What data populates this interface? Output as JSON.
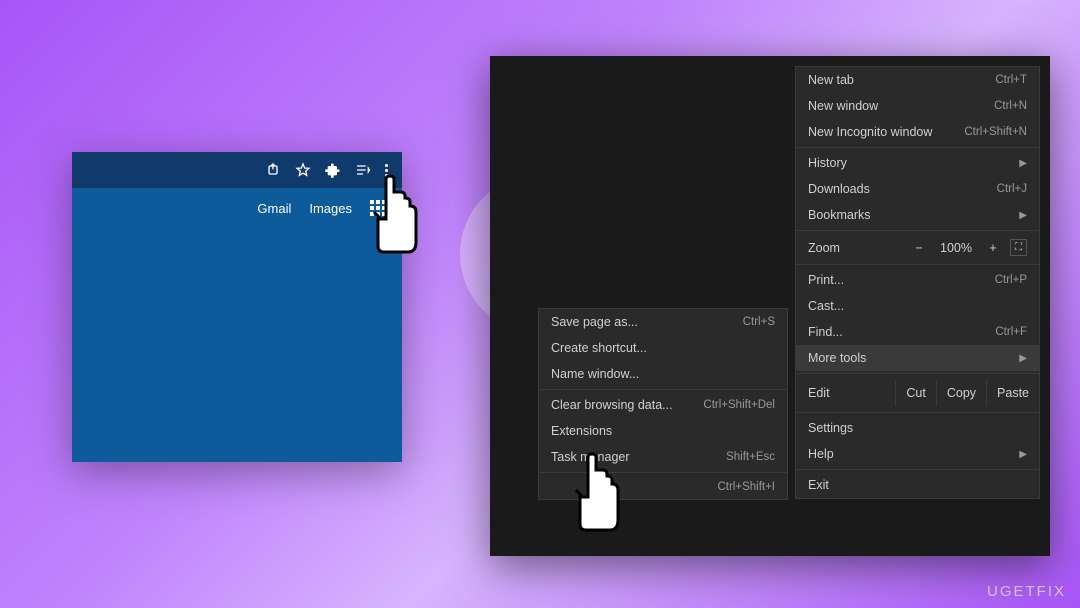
{
  "watermark": "UGETFIX",
  "left_window": {
    "links": {
      "gmail": "Gmail",
      "images": "Images"
    }
  },
  "main_menu": {
    "new_tab": "New tab",
    "new_tab_sc": "Ctrl+T",
    "new_window": "New window",
    "new_window_sc": "Ctrl+N",
    "incognito": "New Incognito window",
    "incognito_sc": "Ctrl+Shift+N",
    "history": "History",
    "downloads": "Downloads",
    "downloads_sc": "Ctrl+J",
    "bookmarks": "Bookmarks",
    "zoom": "Zoom",
    "zoom_minus": "−",
    "zoom_val": "100%",
    "zoom_plus": "+",
    "print": "Print...",
    "print_sc": "Ctrl+P",
    "cast": "Cast...",
    "find": "Find...",
    "find_sc": "Ctrl+F",
    "more_tools": "More tools",
    "edit": "Edit",
    "cut": "Cut",
    "copy": "Copy",
    "paste": "Paste",
    "settings": "Settings",
    "help": "Help",
    "exit": "Exit"
  },
  "submenu": {
    "save_page": "Save page as...",
    "save_page_sc": "Ctrl+S",
    "create_shortcut": "Create shortcut...",
    "name_window": "Name window...",
    "clear_browsing": "Clear browsing data...",
    "clear_browsing_sc": "Ctrl+Shift+Del",
    "extensions": "Extensions",
    "task_manager": "Task manager",
    "task_manager_sc": "Shift+Esc",
    "dev_tools_sc": "Ctrl+Shift+I"
  }
}
